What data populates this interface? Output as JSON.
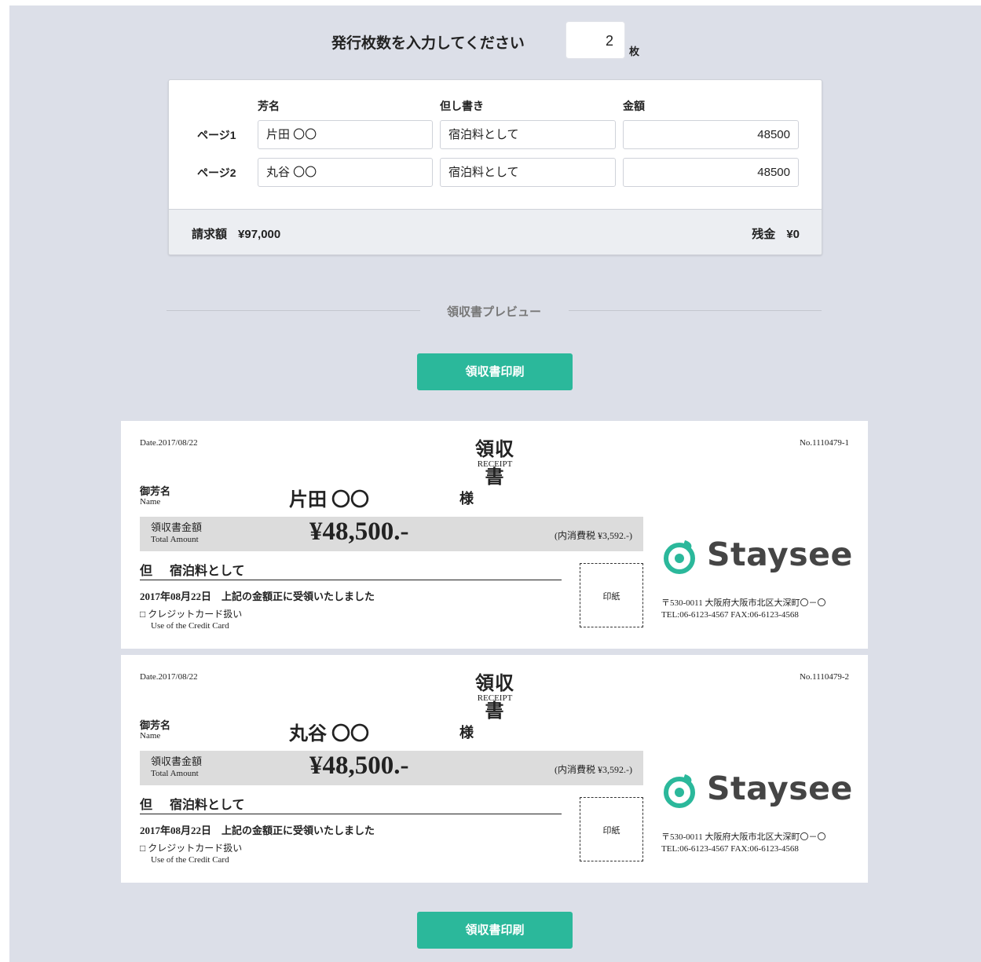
{
  "header": {
    "count_label": "発行枚数を入力してください",
    "count_value": "2",
    "count_unit": "枚"
  },
  "form": {
    "columns": [
      "芳名",
      "但し書き",
      "金額"
    ],
    "rows": [
      {
        "label": "ページ1",
        "name": "片田 〇〇",
        "note": "宿泊料として",
        "amount": "48500"
      },
      {
        "label": "ページ2",
        "name": "丸谷 〇〇",
        "note": "宿泊料として",
        "amount": "48500"
      }
    ],
    "billing_label": "請求額",
    "billing_value": "¥97,000",
    "balance_label": "残金",
    "balance_value": "¥0"
  },
  "preview": {
    "title": "領収書プレビュー",
    "print_button": "領収書印刷"
  },
  "receipts": [
    {
      "date": "Date.2017/08/22",
      "number": "No.1110479-1",
      "title": "領収書",
      "title_en": "RECEIPT",
      "name_label": "御芳名",
      "name_label_en": "Name",
      "name": "片田 〇〇",
      "honorific": "様",
      "amount_label": "領収書金額",
      "amount_label_en": "Total Amount",
      "amount": "¥48,500.-",
      "tax": "(内消費税 ¥3,592.-)",
      "tadashi": "但",
      "note": "宿泊料として",
      "confirm": "2017年08月22日　上記の金額正に受領いたしました",
      "card": "□ クレジットカード扱い",
      "card_en": "Use of the Credit Card",
      "stamp": "印紙",
      "logo": "Staysee",
      "address": "〒530-0011 大阪府大阪市北区大深町〇－〇",
      "tel": "TEL:06-6123-4567 FAX:06-6123-4568"
    },
    {
      "date": "Date.2017/08/22",
      "number": "No.1110479-2",
      "title": "領収書",
      "title_en": "RECEIPT",
      "name_label": "御芳名",
      "name_label_en": "Name",
      "name": "丸谷 〇〇",
      "honorific": "様",
      "amount_label": "領収書金額",
      "amount_label_en": "Total Amount",
      "amount": "¥48,500.-",
      "tax": "(内消費税 ¥3,592.-)",
      "tadashi": "但",
      "note": "宿泊料として",
      "confirm": "2017年08月22日　上記の金額正に受領いたしました",
      "card": "□ クレジットカード扱い",
      "card_en": "Use of the Credit Card",
      "stamp": "印紙",
      "logo": "Staysee",
      "address": "〒530-0011 大阪府大阪市北区大深町〇－〇",
      "tel": "TEL:06-6123-4567 FAX:06-6123-4568"
    }
  ],
  "colors": {
    "background": "#dcdfe8",
    "accent": "#2bb89b",
    "logo_text": "#454545"
  }
}
